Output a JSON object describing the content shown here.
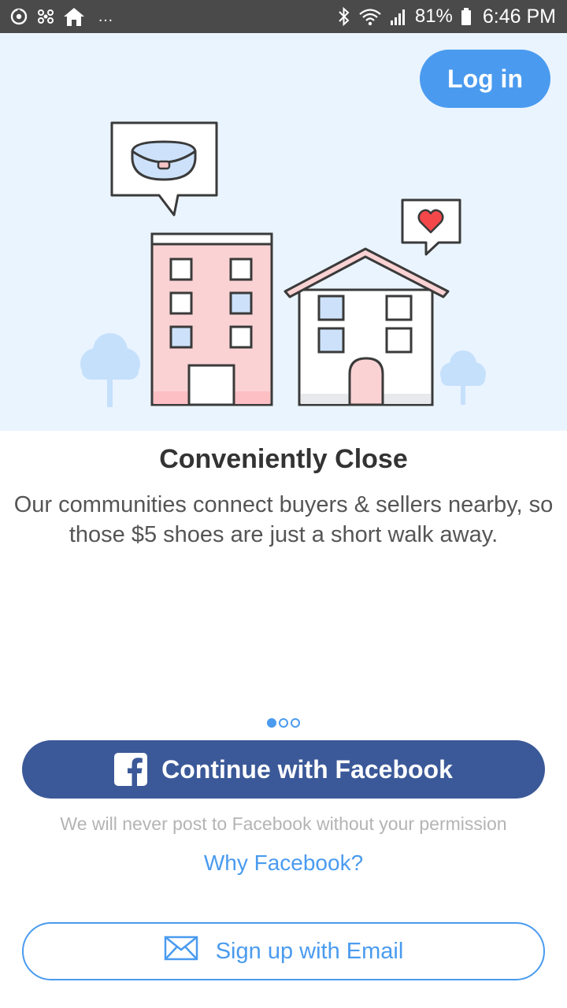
{
  "status_bar": {
    "battery": "81%",
    "time": "6:46 PM",
    "overflow": "…",
    "icons": [
      "sync-icon",
      "fan-icon",
      "home-icon",
      "bluetooth-icon",
      "wifi-icon",
      "signal-icon",
      "battery-icon"
    ]
  },
  "header": {
    "login_label": "Log in"
  },
  "slide": {
    "title": "Conveniently Close",
    "body": "Our communities connect buyers & sellers nearby, so those $5 shoes are just a short walk away.",
    "page_count": 3,
    "active_page": 1
  },
  "facebook": {
    "button_label": "Continue with Facebook",
    "disclaimer": "We will never post to Facebook without your permission",
    "why_label": "Why Facebook?"
  },
  "email": {
    "button_label": "Sign up with Email"
  },
  "colors": {
    "accent": "#4a9bef",
    "facebook": "#3b5998",
    "hero_background": "#eaf4ff",
    "status_bar": "#4a4a4a"
  }
}
